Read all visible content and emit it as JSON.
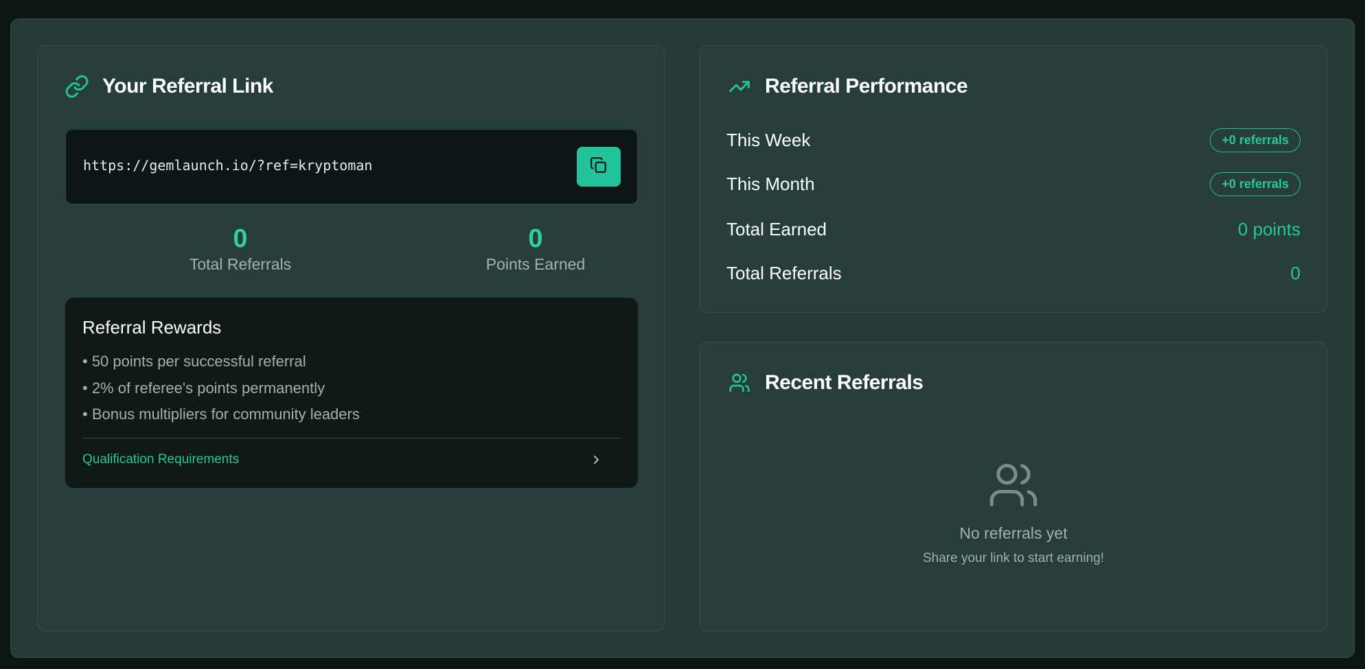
{
  "referral_link_card": {
    "title": "Your Referral Link",
    "title_icon": "link-icon",
    "link": "https://gemlaunch.io/?ref=kryptoman",
    "copy_icon": "copy-icon",
    "stats": [
      {
        "value": "0",
        "label": "Total Referrals"
      },
      {
        "value": "0",
        "label": "Points Earned"
      }
    ],
    "rewards": {
      "title": "Referral Rewards",
      "items": [
        "• 50 points per successful referral",
        "• 2% of referee's points permanently",
        "• Bonus multipliers for community leaders"
      ],
      "qualification_link": "Qualification Requirements"
    }
  },
  "performance_card": {
    "title": "Referral Performance",
    "title_icon": "trending-up-icon",
    "rows": [
      {
        "label": "This Week",
        "value": "+0 referrals"
      },
      {
        "label": "This Month",
        "value": "+0 referrals"
      },
      {
        "label": "Total Earned",
        "value": "0 points"
      },
      {
        "label": "Total Referrals",
        "value": "0"
      }
    ]
  },
  "recent_card": {
    "title": "Recent Referrals",
    "title_icon": "users-icon",
    "empty_title": "No referrals yet",
    "empty_subtitle": "Share your link to start earning!"
  },
  "colors": {
    "accent": "#22c39a",
    "background": "#0b1512",
    "card": "#273d39"
  }
}
